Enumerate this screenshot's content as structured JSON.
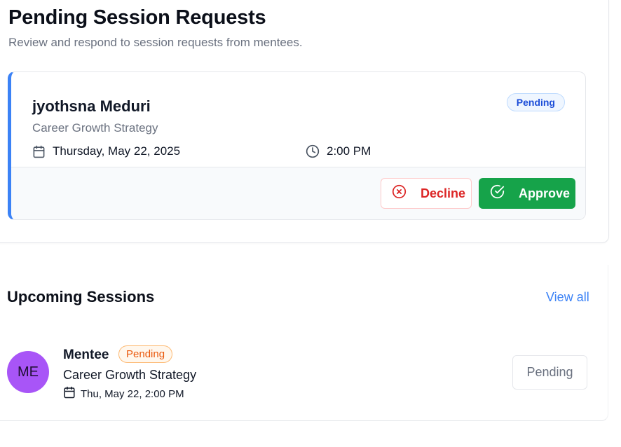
{
  "header": {
    "title": "Pending Session Requests",
    "subtitle": "Review and respond to session requests from mentees."
  },
  "request": {
    "mentee_name": "jyothsna Meduri",
    "status": "Pending",
    "topic": "Career Growth Strategy",
    "date": "Thursday, May 22, 2025",
    "time": "2:00 PM",
    "decline_label": "Decline",
    "approve_label": "Approve"
  },
  "upcoming": {
    "title": "Upcoming Sessions",
    "view_all_label": "View all",
    "sessions": [
      {
        "avatar_initials": "ME",
        "name": "Mentee",
        "status": "Pending",
        "topic": "Career Growth Strategy",
        "datetime": "Thu, May 22, 2:00 PM",
        "action_label": "Pending"
      }
    ]
  },
  "colors": {
    "accent_blue": "#3b82f6",
    "approve_green": "#16a34a",
    "decline_red": "#dc2626",
    "avatar_purple": "#a855f7",
    "pending_orange": "#ea580c"
  },
  "icons": {
    "calendar": "calendar-icon",
    "clock": "clock-icon",
    "decline": "x-circle-icon",
    "approve": "check-circle-icon"
  }
}
